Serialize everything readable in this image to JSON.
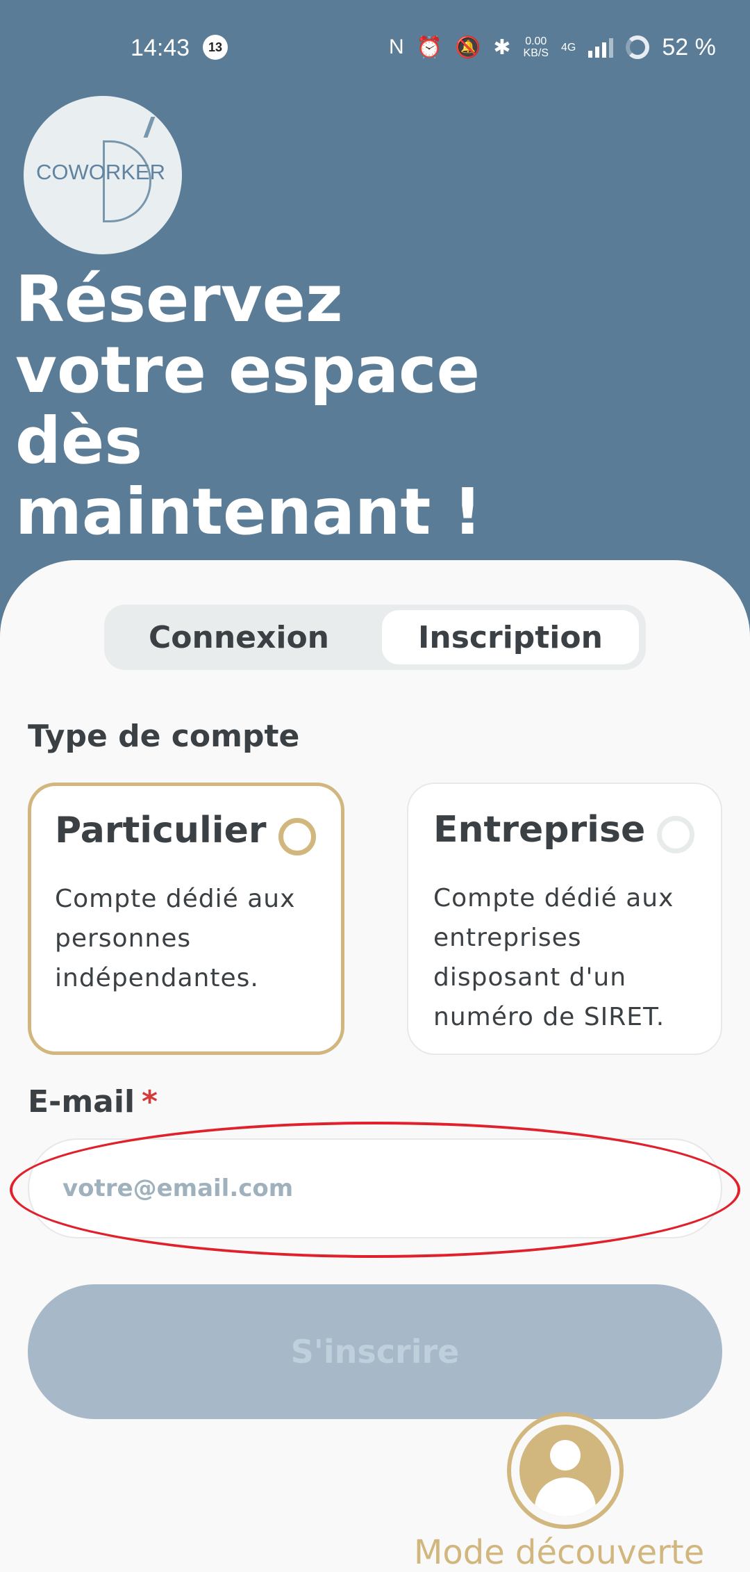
{
  "status_bar": {
    "time": "14:43",
    "notification_count": "13",
    "net_rate_value": "0.00",
    "net_rate_unit": "KB/S",
    "network_type": "4G",
    "battery_percent": "52 %"
  },
  "logo": {
    "text": "COWORKER"
  },
  "hero": {
    "lines": [
      "Réservez",
      "votre espace",
      "dès",
      "maintenant !"
    ]
  },
  "tabs": [
    {
      "label": "Connexion",
      "active": false
    },
    {
      "label": "Inscription",
      "active": true
    }
  ],
  "account_type": {
    "label": "Type de compte",
    "options": [
      {
        "title": "Particulier",
        "description": "Compte dédié aux personnes indépendantes.",
        "selected": true
      },
      {
        "title": "Entreprise",
        "description": "Compte dédié aux entreprises disposant d'un numéro de SIRET.",
        "selected": false
      }
    ]
  },
  "email": {
    "label": "E-mail",
    "required_marker": "*",
    "placeholder": "votre@email.com",
    "value": ""
  },
  "submit": {
    "label": "S'inscrire",
    "enabled": false
  },
  "discover": {
    "label": "Mode découverte"
  },
  "colors": {
    "header_bg": "#5a7c96",
    "accent_gold": "#d1b67d",
    "required_red": "#d33a3a",
    "highlight_red": "#e0202a"
  }
}
